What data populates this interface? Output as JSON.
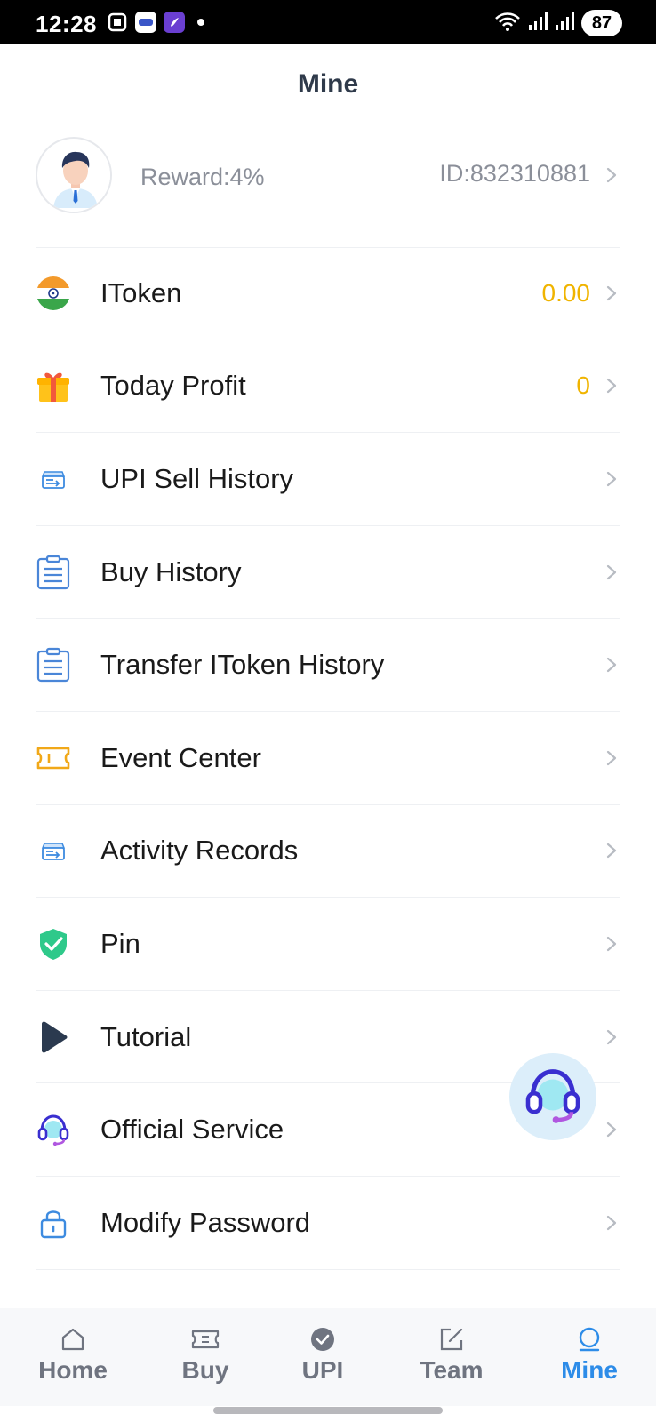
{
  "status_bar": {
    "time": "12:28",
    "battery": "87"
  },
  "header": {
    "title": "Mine"
  },
  "profile": {
    "reward": "Reward:4%",
    "id": "ID:832310881"
  },
  "menu": {
    "items": [
      {
        "label": "IToken",
        "value": "0.00",
        "icon": "india-flag-icon"
      },
      {
        "label": "Today Profit",
        "value": "0",
        "icon": "gift-icon"
      },
      {
        "label": "UPI Sell History",
        "value": "",
        "icon": "transfer-box-icon"
      },
      {
        "label": "Buy History",
        "value": "",
        "icon": "clipboard-icon"
      },
      {
        "label": "Transfer IToken History",
        "value": "",
        "icon": "clipboard-icon"
      },
      {
        "label": "Event Center",
        "value": "",
        "icon": "ticket-icon"
      },
      {
        "label": "Activity Records",
        "value": "",
        "icon": "transfer-box-icon"
      },
      {
        "label": "Pin",
        "value": "",
        "icon": "shield-check-icon"
      },
      {
        "label": "Tutorial",
        "value": "",
        "icon": "play-icon"
      },
      {
        "label": "Official Service",
        "value": "",
        "icon": "headset-icon"
      },
      {
        "label": "Modify Password",
        "value": "",
        "icon": "lock-icon"
      }
    ]
  },
  "bottom_nav": {
    "items": [
      {
        "label": "Home",
        "icon": "home-icon"
      },
      {
        "label": "Buy",
        "icon": "ticket-icon"
      },
      {
        "label": "UPI",
        "icon": "check-circle-icon"
      },
      {
        "label": "Team",
        "icon": "edit-icon"
      },
      {
        "label": "Mine",
        "icon": "user-icon"
      }
    ],
    "active": "Mine"
  },
  "colors": {
    "accent": "#2d8ce8",
    "value": "#f0b400",
    "title": "#2f3a4a",
    "muted": "#8b8f99"
  }
}
